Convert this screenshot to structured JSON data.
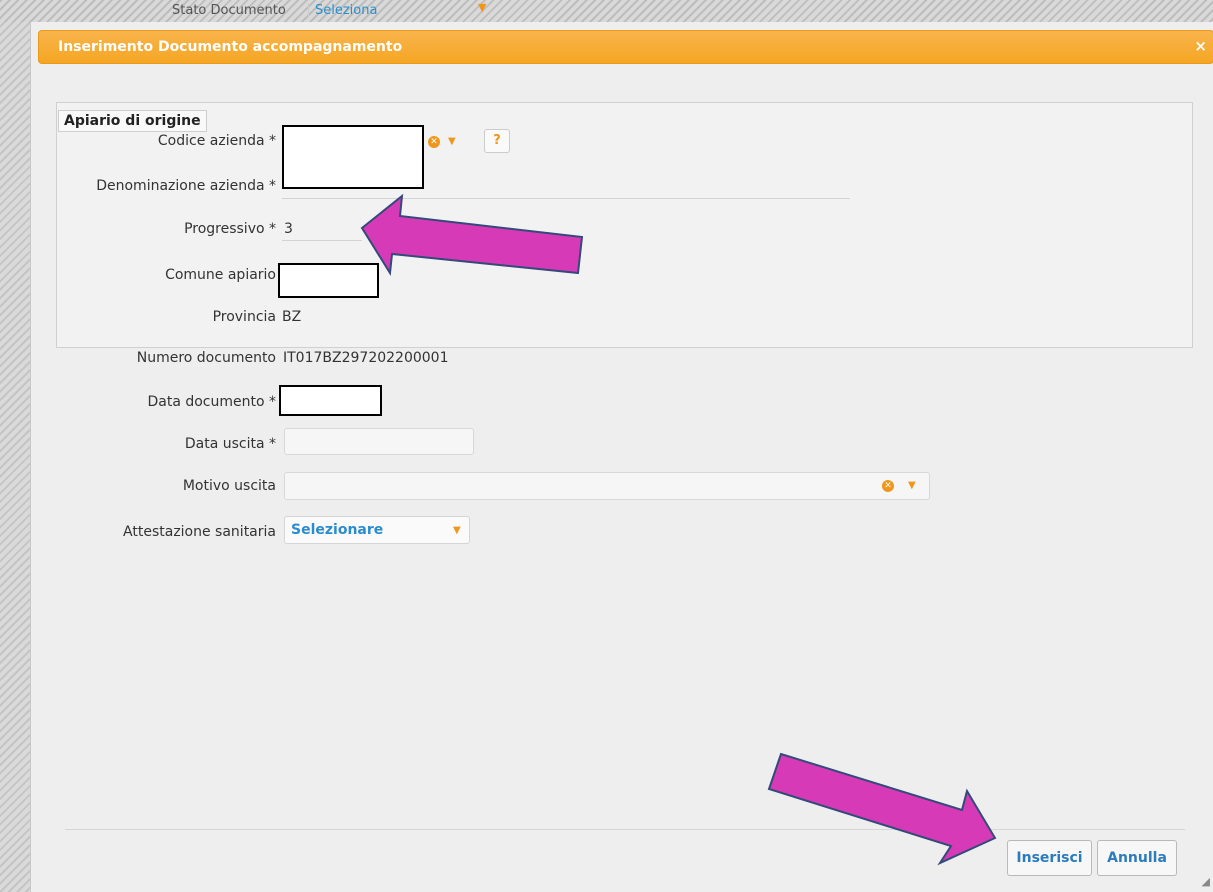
{
  "background_form": {
    "label": "Stato Documento",
    "value": "Seleziona"
  },
  "dialog": {
    "title": "Inserimento Documento accompagnamento",
    "close_label": "×"
  },
  "fieldset": {
    "legend": "Apiario di origine",
    "codice_azienda_label": "Codice azienda *",
    "help_label": "?",
    "denominazione_label": "Denominazione azienda *",
    "progressivo_label": "Progressivo *",
    "progressivo_value": "3",
    "comune_label": "Comune apiario",
    "provincia_label": "Provincia",
    "provincia_value": "BZ"
  },
  "form": {
    "numero_label": "Numero documento",
    "numero_value": "IT017BZ297202200001",
    "data_documento_label": "Data documento *",
    "data_uscita_label": "Data uscita *",
    "motivo_label": "Motivo uscita",
    "attestazione_label": "Attestazione sanitaria",
    "attestazione_value": "Selezionare"
  },
  "buttons": {
    "inserisci": "Inserisci",
    "annulla": "Annulla"
  },
  "colors": {
    "titlebar": "#f5a623",
    "accent": "#2b8ccd",
    "annotation_arrow": "#d63ab6"
  },
  "icons": [
    "clear-icon",
    "chevron-down-icon",
    "help-icon",
    "close-icon",
    "resize-grip-icon"
  ]
}
